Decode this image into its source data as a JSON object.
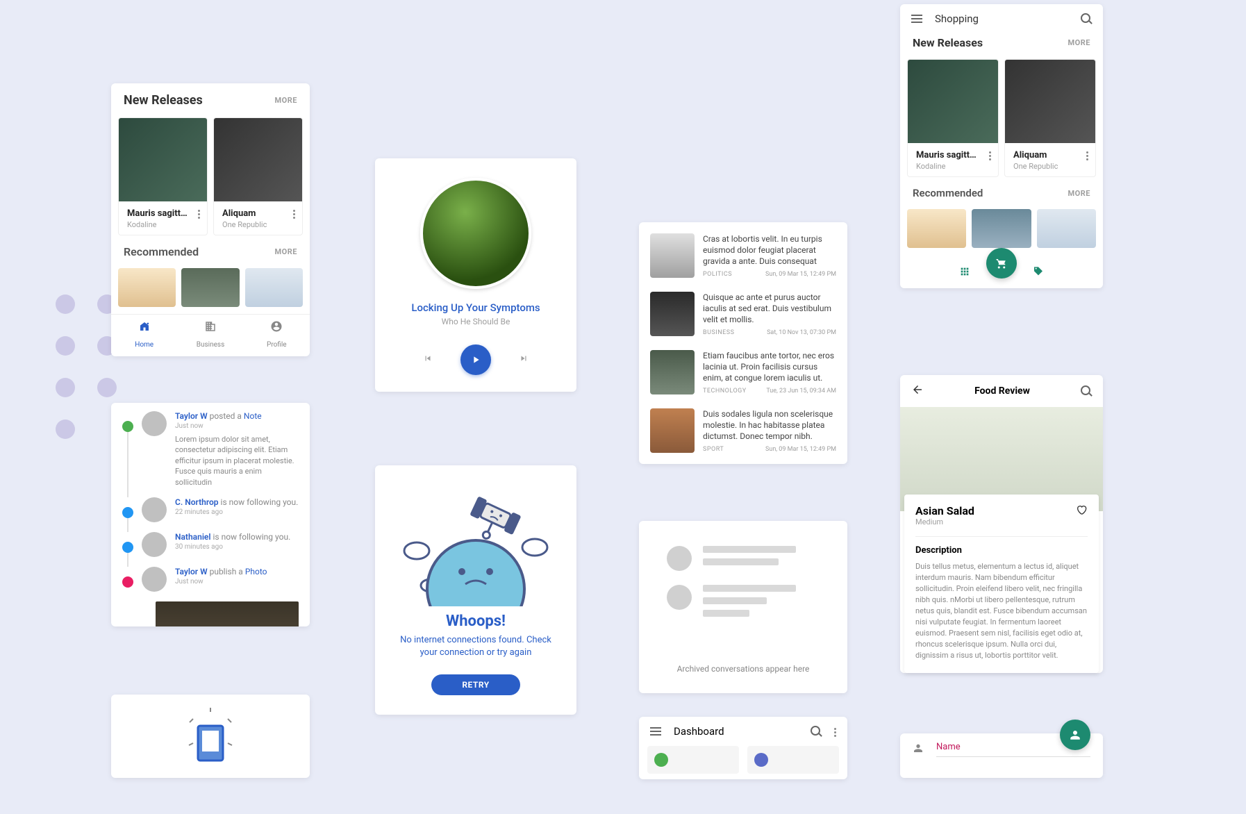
{
  "colors": {
    "accent": "#2a5ec7",
    "teal": "#1d8a70",
    "danger": "#c2185b"
  },
  "releases": {
    "title": "New Releases",
    "more": "MORE",
    "items": [
      {
        "title": "Mauris sagittis...",
        "subtitle": "Kodaline"
      },
      {
        "title": "Aliquam",
        "subtitle": "One Republic"
      }
    ]
  },
  "recommended": {
    "title": "Recommended",
    "more": "MORE"
  },
  "bottom_nav": {
    "items": [
      {
        "label": "Home",
        "active": true
      },
      {
        "label": "Business",
        "active": false
      },
      {
        "label": "Profile",
        "active": false
      }
    ]
  },
  "music": {
    "track": "Locking Up Your Symptoms",
    "artist": "Who He Should Be"
  },
  "whoops": {
    "title": "Whoops!",
    "message": "No internet connections found. Check your connection or try again",
    "retry": "RETRY"
  },
  "feed": [
    {
      "text": "Cras at lobortis velit. In eu turpis euismod dolor feugiat placerat gravida a ante. Duis consequat",
      "cat": "POLITICS",
      "time": "Sun, 09 Mar 15, 12:49 PM"
    },
    {
      "text": "Quisque ac ante et purus auctor iaculis at sed erat. Duis vestibulum velit et mollis.",
      "cat": "BUSINESS",
      "time": "Sat, 10 Nov 13, 07:30 PM"
    },
    {
      "text": "Etiam faucibus ante tortor, nec eros lacinia ut. Proin facilisis cursus enim, at congue lorem iaculis ut.",
      "cat": "TECHNOLOGY",
      "time": "Tue, 23 Jun 15, 09:34 AM"
    },
    {
      "text": "Duis sodales ligula non scelerisque molestie. In hac habitasse platea dictumst. Donec tempor nibh.",
      "cat": "SPORT",
      "time": "Sun, 09 Mar 15, 12:49 PM"
    }
  ],
  "archive": {
    "text": "Archived conversations appear here"
  },
  "timeline": [
    {
      "user": "Taylor W",
      "action": "posted a",
      "object": "Note",
      "time": "Just now",
      "badge": "#4caf50",
      "para": "Lorem ipsum dolor sit amet, consectetur adipiscing elit. Etiam efficitur ipsum in placerat molestie.  Fusce quis mauris a enim sollicitudin"
    },
    {
      "user": "C. Northrop",
      "action": "is now following you.",
      "object": "",
      "time": "22 minutes ago",
      "badge": "#2196f3"
    },
    {
      "user": "Nathaniel",
      "action": "is now following you.",
      "object": "",
      "time": "30 minutes ago",
      "badge": "#2196f3"
    },
    {
      "user": "Taylor W",
      "action": "publish a",
      "object": "Photo",
      "time": "Just now",
      "badge": "#e91e63"
    }
  ],
  "shopping": {
    "title": "Shopping"
  },
  "food": {
    "header": "Food Review",
    "title": "Asian Salad",
    "subtitle": "Medium",
    "section": "Description",
    "desc": "Duis tellus metus, elementum a lectus id, aliquet interdum mauris. Nam bibendum efficitur sollicitudin. Proin eleifend libero velit, nec fringilla nibh quis. nMorbi ut libero pellentesque, rutrum netus quis, blandit est. Fusce bibendum accumsan nisi vulputate feugiat. In fermentum laoreet euismod. Praesent sem nisl, facilisis eget odio at, rhoncus scelerisque ipsum. Nulla orci dui, dignissim a risus ut, lobortis porttitor velit."
  },
  "dashboard": {
    "title": "Dashboard"
  },
  "namecard": {
    "label": "Name"
  }
}
